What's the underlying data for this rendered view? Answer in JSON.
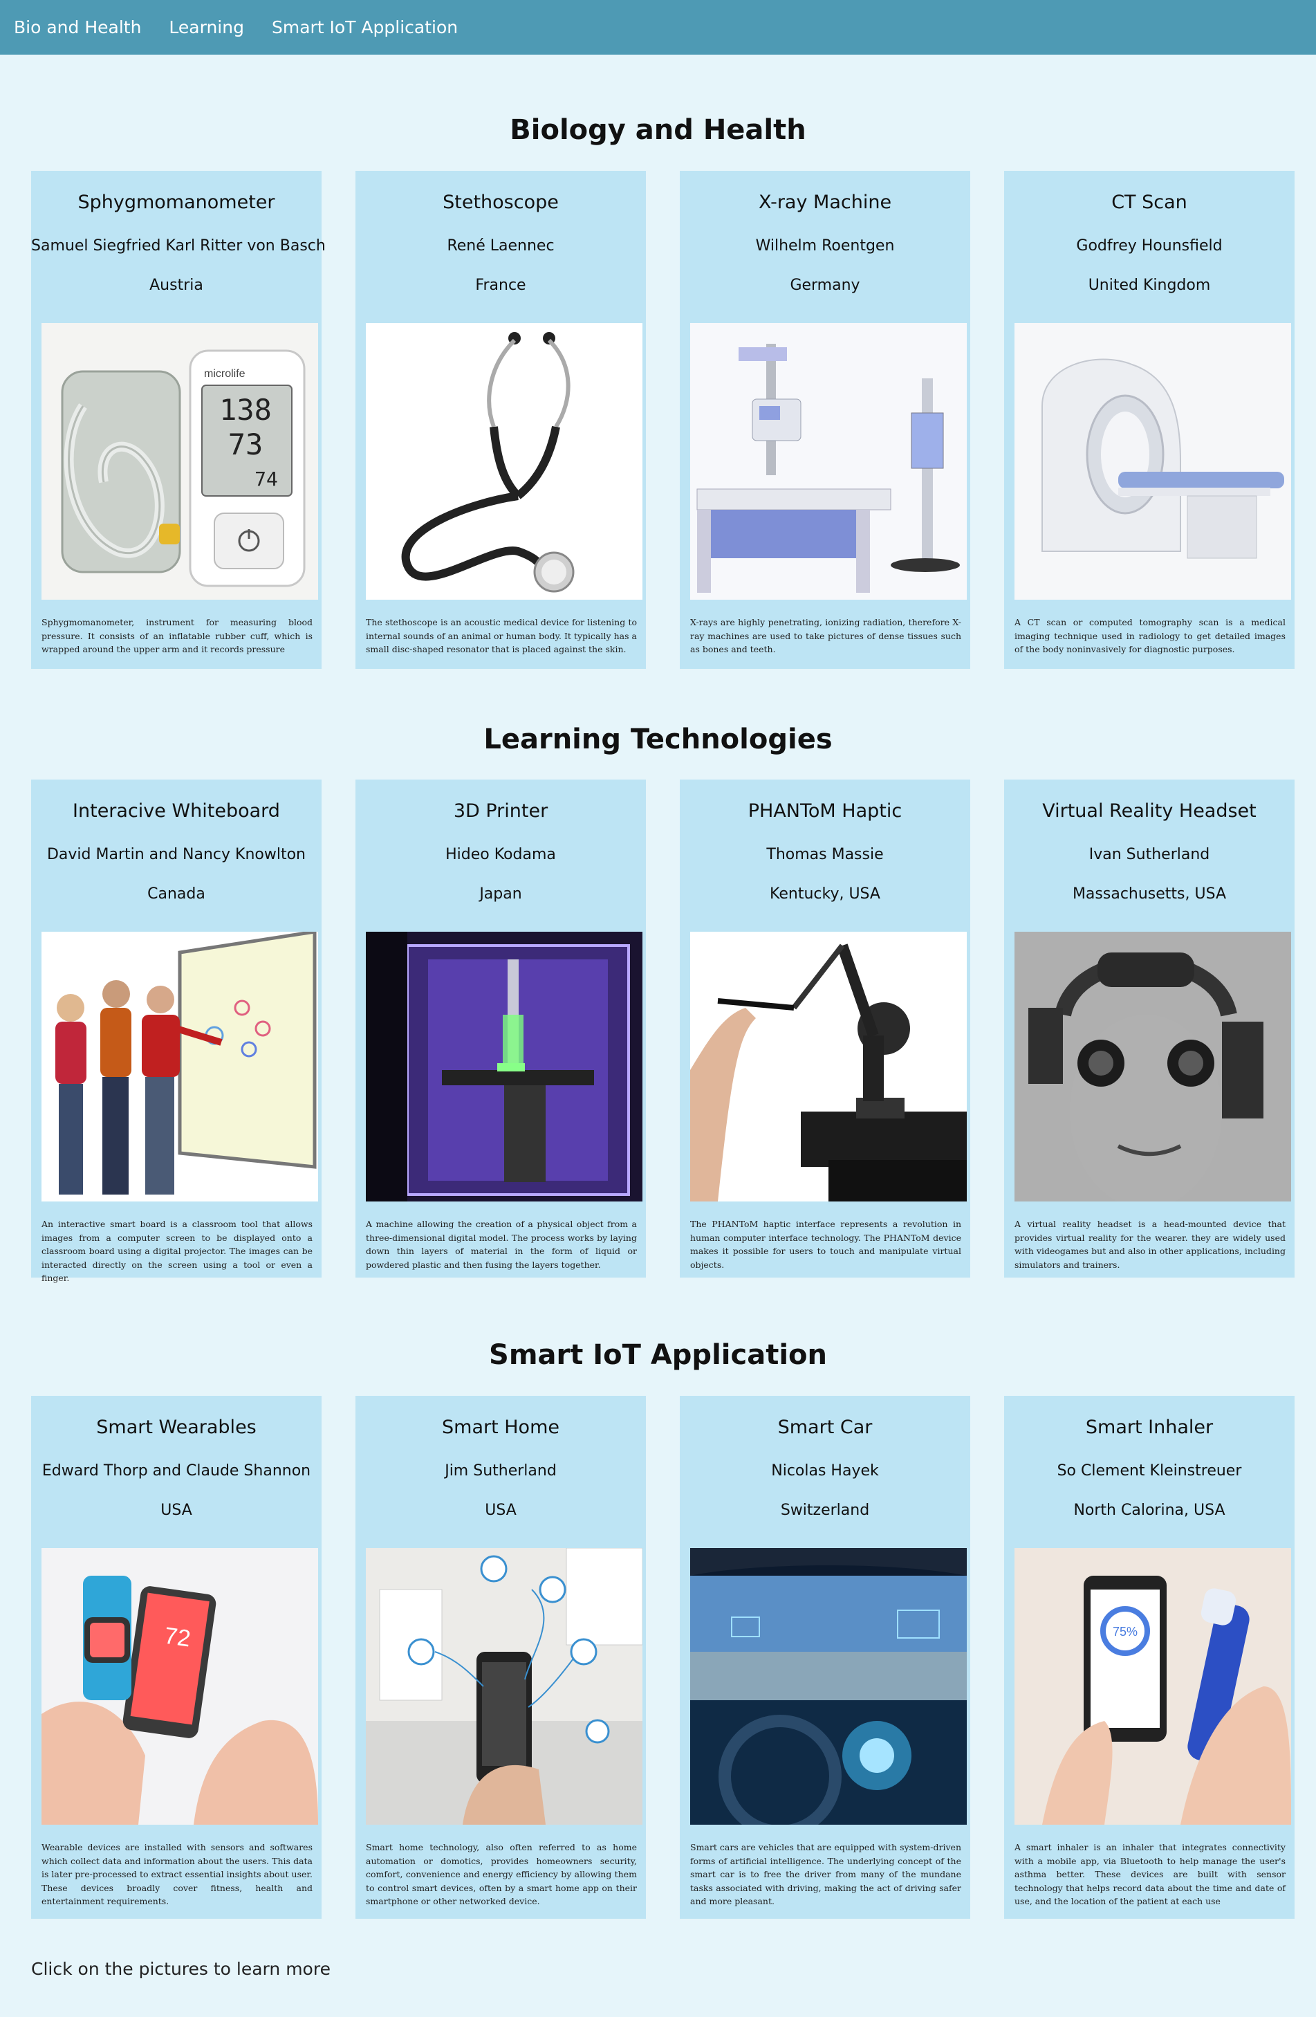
{
  "nav": {
    "links": [
      "Bio and Health",
      "Learning",
      "Smart IoT Application"
    ]
  },
  "sections": [
    {
      "title": "Biology and Health",
      "cards": [
        {
          "title": "Sphygmomanometer",
          "inventor": "Samuel Siegfried Karl Ritter von Basch",
          "country": "Austria",
          "description": "Sphygmomanometer, instrument for measuring blood pressure. It consists of an inflatable rubber cuff, which is wrapped around the upper arm and it records pressure",
          "image": "blood-pressure-monitor-photo",
          "readout": [
            "138",
            "73",
            "74"
          ],
          "brand": "microlife"
        },
        {
          "title": "Stethoscope",
          "inventor": "René Laennec",
          "country": "France",
          "description": "The stethoscope is an acoustic medical device for listening to internal sounds of an animal or human body. It typically has a small disc-shaped resonator that is placed against the skin.",
          "image": "stethoscope-photo"
        },
        {
          "title": "X-ray Machine",
          "inventor": "Wilhelm Roentgen",
          "country": "Germany",
          "description": "X-rays are highly penetrating, ionizing radiation, therefore X-ray machines are used to take pictures of dense tissues such as bones and teeth.",
          "image": "x-ray-machine-photo"
        },
        {
          "title": "CT Scan",
          "inventor": "Godfrey Hounsfield",
          "country": "United Kingdom",
          "description": "A CT scan or computed tomography scan is a medical imaging technique used in radiology to get detailed images of the body noninvasively for diagnostic purposes.",
          "image": "ct-scanner-photo"
        }
      ]
    },
    {
      "title": "Learning Technologies",
      "cards": [
        {
          "title": "Interacive Whiteboard",
          "inventor": "David Martin and Nancy Knowlton",
          "country": "Canada",
          "description": "An interactive smart board is a classroom tool that allows images from a computer screen to be displayed onto a classroom board using a digital projector. The images can be interacted directly on the screen using a tool or even a finger.",
          "image": "interactive-whiteboard-photo"
        },
        {
          "title": "3D Printer",
          "inventor": "Hideo Kodama",
          "country": "Japan",
          "description": "A machine allowing the creation of a physical object from a three-dimensional digital model. The process works by laying down thin layers of material in the form of liquid or powdered plastic and then fusing the layers together.",
          "image": "3d-printer-photo"
        },
        {
          "title": "PHANToM Haptic",
          "inventor": "Thomas Massie",
          "country": "Kentucky, USA",
          "description": "The PHANToM haptic interface represents a revolution in human computer interface technology. The PHANToM device makes it possible for users to touch and manipulate virtual objects.",
          "image": "haptic-device-photo"
        },
        {
          "title": "Virtual Reality Headset",
          "inventor": "Ivan Sutherland",
          "country": "Massachusetts, USA",
          "description": "A virtual reality headset is a head-mounted device that provides virtual reality for the wearer. they are widely used with videogames but and also in other applications, including simulators and trainers.",
          "image": "vr-headset-photo"
        }
      ]
    },
    {
      "title": "Smart IoT Application",
      "cards": [
        {
          "title": "Smart Wearables",
          "inventor": "Edward Thorp and Claude Shannon",
          "country": "USA",
          "description": "Wearable devices are installed with sensors and softwares which collect data and information about the users. This data is later pre-processed to extract essential insights about user. These devices broadly cover fitness, health and entertainment requirements.",
          "image": "smart-wearables-photo",
          "screen_text": "72"
        },
        {
          "title": "Smart Home",
          "inventor": "Jim Sutherland",
          "country": "USA",
          "description": "Smart home technology, also often referred to as home automation or domotics, provides homeowners security, comfort, convenience and energy efficiency by allowing them to control smart devices, often by a smart home app on their smartphone or other networked device.",
          "image": "smart-home-photo"
        },
        {
          "title": "Smart Car",
          "inventor": "Nicolas Hayek",
          "country": "Switzerland",
          "description": "Smart cars are vehicles that are equipped with system-driven forms of artificial intelligence. The underlying concept of the smart car is to free the driver from many of the mundane tasks associated with driving, making the act of driving safer and more pleasant.",
          "image": "smart-car-photo"
        },
        {
          "title": "Smart Inhaler",
          "inventor": "So Clement Kleinstreuer",
          "country": "North Calorina, USA",
          "description": "A smart inhaler is an inhaler that integrates connectivity with a mobile app, via Bluetooth to help manage the user's asthma better. These devices are built with sensor technology that helps record data about the time and date of use, and the location of the patient at each use",
          "image": "smart-inhaler-photo",
          "screen_text": "75%"
        }
      ]
    }
  ],
  "footer": {
    "note": "Click on the pictures to learn more"
  },
  "colors": {
    "navbar": "#4e9ab4",
    "page_background": "#e6f5fa",
    "card_background": "#bde4f4",
    "nav_text": "#ffffff"
  }
}
